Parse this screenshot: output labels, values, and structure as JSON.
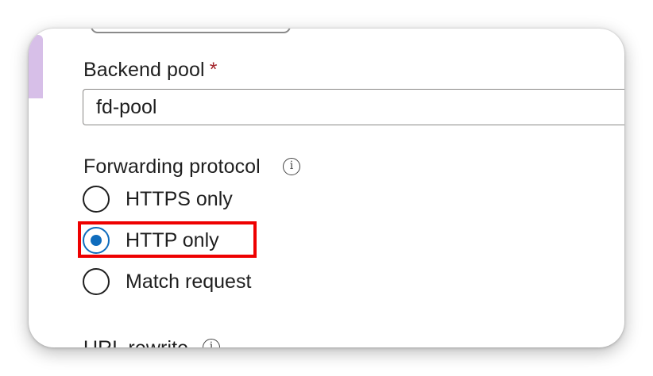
{
  "backend_pool": {
    "label": "Backend pool",
    "required_marker": "*",
    "value": "fd-pool"
  },
  "forwarding_protocol": {
    "label": "Forwarding protocol",
    "info_icon": "info-icon",
    "options": [
      {
        "label": "HTTPS only",
        "selected": false
      },
      {
        "label": "HTTP only",
        "selected": true
      },
      {
        "label": "Match request",
        "selected": false
      }
    ],
    "selected_value": "HTTP only"
  },
  "url_rewrite": {
    "label": "URL rewrite",
    "info_icon": "info-icon"
  },
  "colors": {
    "accent": "#0f6cbd",
    "required": "#a4262c",
    "highlight": "#ee0000",
    "sidebar_accent": "#d7bfe8"
  }
}
